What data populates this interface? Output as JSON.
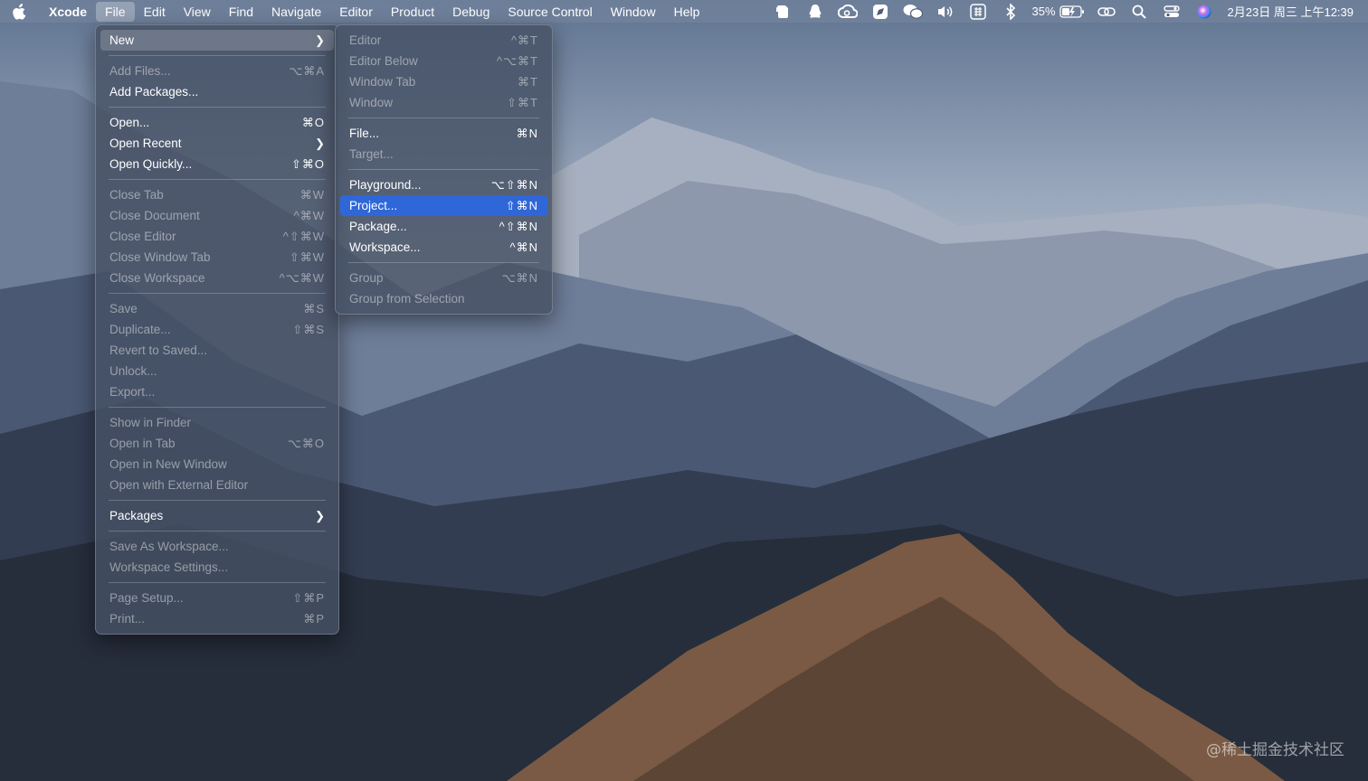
{
  "menubar": {
    "app_name": "Xcode",
    "menus": [
      "File",
      "Edit",
      "View",
      "Find",
      "Navigate",
      "Editor",
      "Product",
      "Debug",
      "Source Control",
      "Window",
      "Help"
    ],
    "battery": "35%",
    "clock": "2月23日 周三 上午12:39"
  },
  "file_menu": {
    "new": {
      "label": "New",
      "shortcut": ""
    },
    "add_files": {
      "label": "Add Files...",
      "shortcut": "⌥⌘A"
    },
    "add_packages": {
      "label": "Add Packages...",
      "shortcut": ""
    },
    "open": {
      "label": "Open...",
      "shortcut": "⌘O"
    },
    "open_recent": {
      "label": "Open Recent",
      "shortcut": ""
    },
    "open_quickly": {
      "label": "Open Quickly...",
      "shortcut": "⇧⌘O"
    },
    "close_tab": {
      "label": "Close Tab",
      "shortcut": "⌘W"
    },
    "close_document": {
      "label": "Close Document",
      "shortcut": "^⌘W"
    },
    "close_editor": {
      "label": "Close Editor",
      "shortcut": "^⇧⌘W"
    },
    "close_window_tab": {
      "label": "Close Window Tab",
      "shortcut": "⇧⌘W"
    },
    "close_workspace": {
      "label": "Close Workspace",
      "shortcut": "^⌥⌘W"
    },
    "save": {
      "label": "Save",
      "shortcut": "⌘S"
    },
    "duplicate": {
      "label": "Duplicate...",
      "shortcut": "⇧⌘S"
    },
    "revert": {
      "label": "Revert to Saved...",
      "shortcut": ""
    },
    "unlock": {
      "label": "Unlock...",
      "shortcut": ""
    },
    "export": {
      "label": "Export...",
      "shortcut": ""
    },
    "show_in_finder": {
      "label": "Show in Finder",
      "shortcut": ""
    },
    "open_in_tab": {
      "label": "Open in Tab",
      "shortcut": "⌥⌘O"
    },
    "open_new_window": {
      "label": "Open in New Window",
      "shortcut": ""
    },
    "open_external": {
      "label": "Open with External Editor",
      "shortcut": ""
    },
    "packages": {
      "label": "Packages",
      "shortcut": ""
    },
    "save_as_workspace": {
      "label": "Save As Workspace...",
      "shortcut": ""
    },
    "workspace_settings": {
      "label": "Workspace Settings...",
      "shortcut": ""
    },
    "page_setup": {
      "label": "Page Setup...",
      "shortcut": "⇧⌘P"
    },
    "print": {
      "label": "Print...",
      "shortcut": "⌘P"
    }
  },
  "new_submenu": {
    "editor": {
      "label": "Editor",
      "shortcut": "^⌘T"
    },
    "editor_below": {
      "label": "Editor Below",
      "shortcut": "^⌥⌘T"
    },
    "window_tab": {
      "label": "Window Tab",
      "shortcut": "⌘T"
    },
    "window": {
      "label": "Window",
      "shortcut": "⇧⌘T"
    },
    "file": {
      "label": "File...",
      "shortcut": "⌘N"
    },
    "target": {
      "label": "Target...",
      "shortcut": ""
    },
    "playground": {
      "label": "Playground...",
      "shortcut": "⌥⇧⌘N"
    },
    "project": {
      "label": "Project...",
      "shortcut": "⇧⌘N"
    },
    "package": {
      "label": "Package...",
      "shortcut": "^⇧⌘N"
    },
    "workspace": {
      "label": "Workspace...",
      "shortcut": "^⌘N"
    },
    "group": {
      "label": "Group",
      "shortcut": "⌥⌘N"
    },
    "group_from_selection": {
      "label": "Group from Selection",
      "shortcut": ""
    }
  },
  "watermark": "@稀土掘金技术社区",
  "colors": {
    "highlight": "#2f67d8",
    "menu_bg": "#464f64"
  }
}
